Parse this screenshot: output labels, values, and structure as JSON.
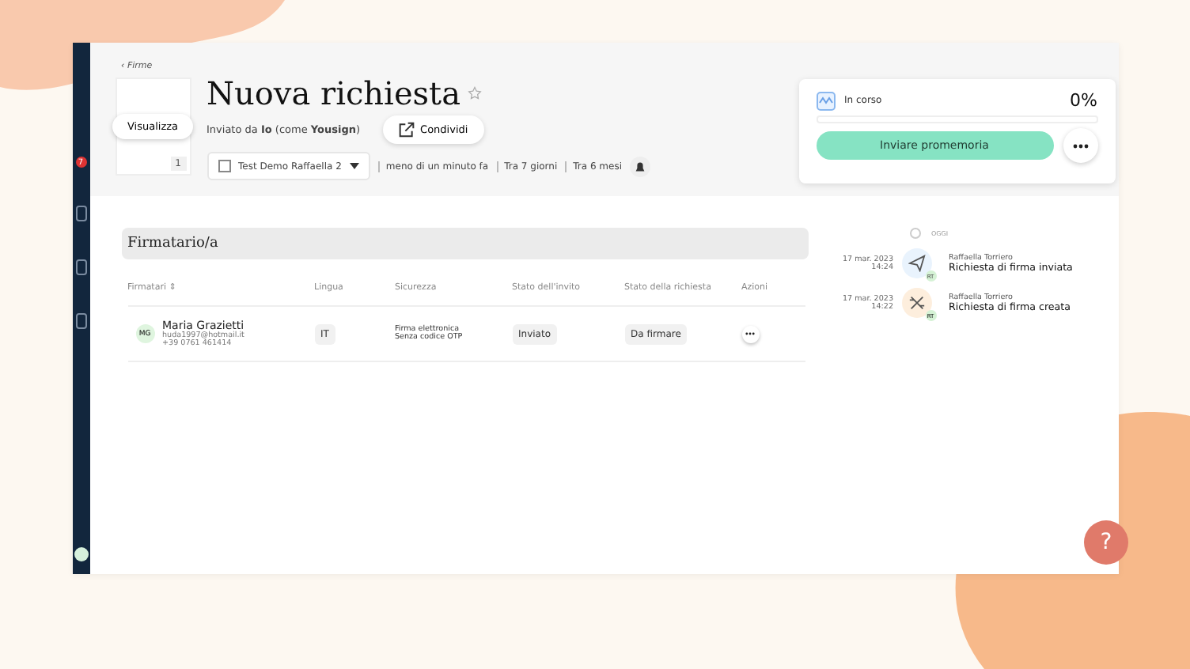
{
  "breadcrumb": "‹ Firme",
  "document": {
    "preview_button": "Visualizza",
    "page_count": "1"
  },
  "title": "Nuova richiesta",
  "starred": false,
  "sent_by": "Inviato da **Io** (come **Yousign**)",
  "share_button": "Condividi",
  "workspace": "Test Demo Raffaella 2",
  "meta": [
    "meno di un minuto fa",
    "Tra 7 giorni",
    "Tra 6 mesi"
  ],
  "status_card": {
    "label": "In corso",
    "percent": "0%",
    "level": 0,
    "reminder_button": "Inviare promemoria"
  },
  "signers_section": {
    "title": "Firmatario/a",
    "columns": [
      "Firmatari ⇕",
      "Lingua",
      "Sicurezza",
      "Stato dell'invito",
      "Stato della richiesta",
      "Azioni"
    ],
    "rows": [
      {
        "initials": "MG",
        "name": "Maria Grazietti",
        "email": "huda1997@hotmail.it",
        "phone": "+39 0761 461414",
        "language": "IT",
        "security": [
          "Firma elettronica",
          "Senza codice OTP"
        ],
        "invite_status": "Inviato",
        "request_status": "Da firmare"
      }
    ]
  },
  "timeline": {
    "heading": "OGGI",
    "events": [
      {
        "date": "17 mar. 2023",
        "time": "14:24",
        "author": "Raffaella Torriero",
        "initials": "RT",
        "event": "Richiesta di firma inviata",
        "kind": "sent"
      },
      {
        "date": "17 mar. 2023",
        "time": "14:22",
        "author": "Raffaella Torriero",
        "initials": "RT",
        "event": "Richiesta di firma creata",
        "kind": "created"
      }
    ]
  },
  "sidebar_badge": "7",
  "help_button": "?"
}
